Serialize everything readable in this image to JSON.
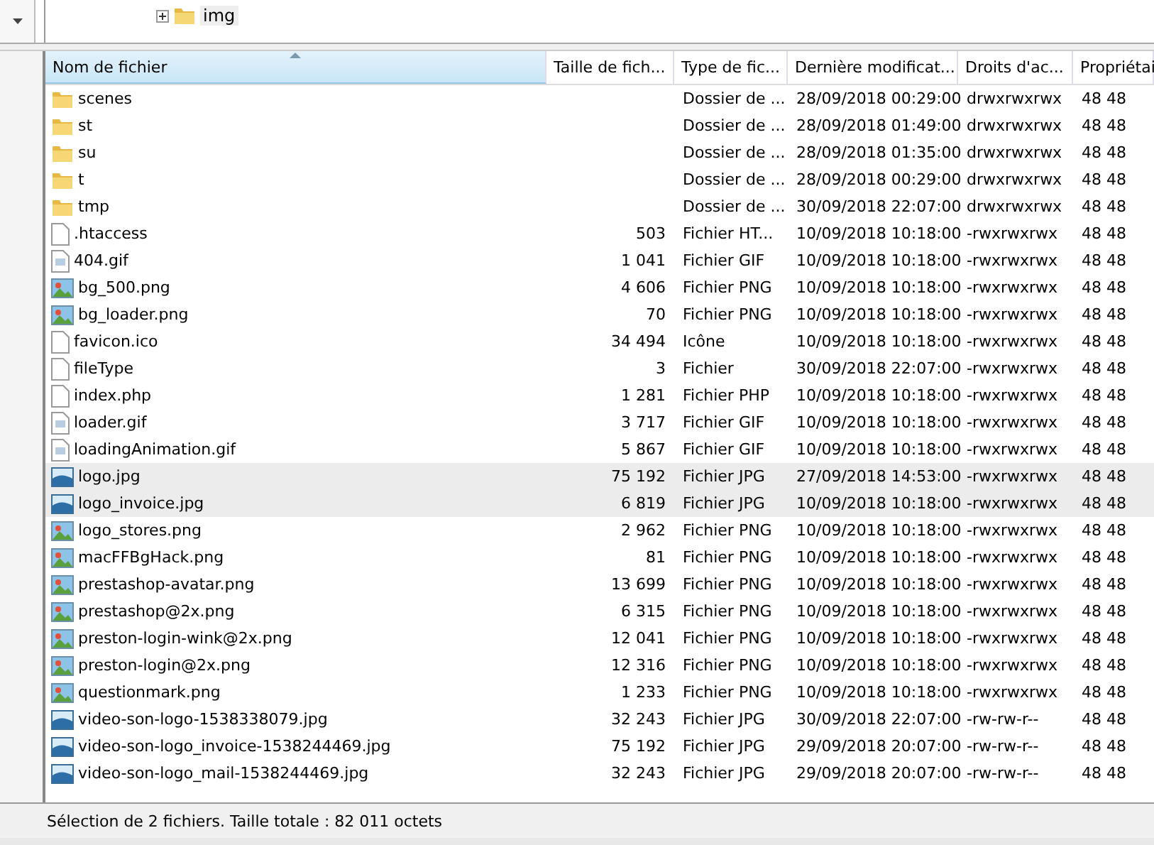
{
  "tree": {
    "items": [
      {
        "label": "img",
        "expanded": false
      }
    ]
  },
  "table": {
    "columns": [
      {
        "label": "Nom de fichier",
        "sorted": true
      },
      {
        "label": "Taille de fich...",
        "sorted": false
      },
      {
        "label": "Type de fic...",
        "sorted": false
      },
      {
        "label": "Dernière modificat...",
        "sorted": false
      },
      {
        "label": "Droits d'ac...",
        "sorted": false
      },
      {
        "label": "Propriétai",
        "sorted": false
      }
    ],
    "rows": [
      {
        "kind": "folder",
        "name": "scenes",
        "size": "",
        "type": "Dossier de ...",
        "date": "28/09/2018 00:29:00",
        "rights": "drwxrwxrwx",
        "owner": "48 48",
        "selected": false
      },
      {
        "kind": "folder",
        "name": "st",
        "size": "",
        "type": "Dossier de ...",
        "date": "28/09/2018 01:49:00",
        "rights": "drwxrwxrwx",
        "owner": "48 48",
        "selected": false
      },
      {
        "kind": "folder",
        "name": "su",
        "size": "",
        "type": "Dossier de ...",
        "date": "28/09/2018 01:35:00",
        "rights": "drwxrwxrwx",
        "owner": "48 48",
        "selected": false
      },
      {
        "kind": "folder",
        "name": "t",
        "size": "",
        "type": "Dossier de ...",
        "date": "28/09/2018 00:29:00",
        "rights": "drwxrwxrwx",
        "owner": "48 48",
        "selected": false
      },
      {
        "kind": "folder",
        "name": "tmp",
        "size": "",
        "type": "Dossier de ...",
        "date": "30/09/2018 22:07:00",
        "rights": "drwxrwxrwx",
        "owner": "48 48",
        "selected": false
      },
      {
        "kind": "blank",
        "name": ".htaccess",
        "size": "503",
        "type": "Fichier HT...",
        "date": "10/09/2018 10:18:00",
        "rights": "-rwxrwxrwx",
        "owner": "48 48",
        "selected": false
      },
      {
        "kind": "gif",
        "name": "404.gif",
        "size": "1 041",
        "type": "Fichier GIF",
        "date": "10/09/2018 10:18:00",
        "rights": "-rwxrwxrwx",
        "owner": "48 48",
        "selected": false
      },
      {
        "kind": "png",
        "name": "bg_500.png",
        "size": "4 606",
        "type": "Fichier PNG",
        "date": "10/09/2018 10:18:00",
        "rights": "-rwxrwxrwx",
        "owner": "48 48",
        "selected": false
      },
      {
        "kind": "png",
        "name": "bg_loader.png",
        "size": "70",
        "type": "Fichier PNG",
        "date": "10/09/2018 10:18:00",
        "rights": "-rwxrwxrwx",
        "owner": "48 48",
        "selected": false
      },
      {
        "kind": "blank",
        "name": "favicon.ico",
        "size": "34 494",
        "type": "Icône",
        "date": "10/09/2018 10:18:00",
        "rights": "-rwxrwxrwx",
        "owner": "48 48",
        "selected": false
      },
      {
        "kind": "blank",
        "name": "fileType",
        "size": "3",
        "type": "Fichier",
        "date": "30/09/2018 22:07:00",
        "rights": "-rwxrwxrwx",
        "owner": "48 48",
        "selected": false
      },
      {
        "kind": "blank",
        "name": "index.php",
        "size": "1 281",
        "type": "Fichier PHP",
        "date": "10/09/2018 10:18:00",
        "rights": "-rwxrwxrwx",
        "owner": "48 48",
        "selected": false
      },
      {
        "kind": "gif",
        "name": "loader.gif",
        "size": "3 717",
        "type": "Fichier GIF",
        "date": "10/09/2018 10:18:00",
        "rights": "-rwxrwxrwx",
        "owner": "48 48",
        "selected": false
      },
      {
        "kind": "gif",
        "name": "loadingAnimation.gif",
        "size": "5 867",
        "type": "Fichier GIF",
        "date": "10/09/2018 10:18:00",
        "rights": "-rwxrwxrwx",
        "owner": "48 48",
        "selected": false
      },
      {
        "kind": "jpg",
        "name": "logo.jpg",
        "size": "75 192",
        "type": "Fichier JPG",
        "date": "27/09/2018 14:53:00",
        "rights": "-rwxrwxrwx",
        "owner": "48 48",
        "selected": true
      },
      {
        "kind": "jpg",
        "name": "logo_invoice.jpg",
        "size": "6 819",
        "type": "Fichier JPG",
        "date": "10/09/2018 10:18:00",
        "rights": "-rwxrwxrwx",
        "owner": "48 48",
        "selected": true
      },
      {
        "kind": "png",
        "name": "logo_stores.png",
        "size": "2 962",
        "type": "Fichier PNG",
        "date": "10/09/2018 10:18:00",
        "rights": "-rwxrwxrwx",
        "owner": "48 48",
        "selected": false
      },
      {
        "kind": "png",
        "name": "macFFBgHack.png",
        "size": "81",
        "type": "Fichier PNG",
        "date": "10/09/2018 10:18:00",
        "rights": "-rwxrwxrwx",
        "owner": "48 48",
        "selected": false
      },
      {
        "kind": "png",
        "name": "prestashop-avatar.png",
        "size": "13 699",
        "type": "Fichier PNG",
        "date": "10/09/2018 10:18:00",
        "rights": "-rwxrwxrwx",
        "owner": "48 48",
        "selected": false
      },
      {
        "kind": "png",
        "name": "prestashop@2x.png",
        "size": "6 315",
        "type": "Fichier PNG",
        "date": "10/09/2018 10:18:00",
        "rights": "-rwxrwxrwx",
        "owner": "48 48",
        "selected": false
      },
      {
        "kind": "png",
        "name": "preston-login-wink@2x.png",
        "size": "12 041",
        "type": "Fichier PNG",
        "date": "10/09/2018 10:18:00",
        "rights": "-rwxrwxrwx",
        "owner": "48 48",
        "selected": false
      },
      {
        "kind": "png",
        "name": "preston-login@2x.png",
        "size": "12 316",
        "type": "Fichier PNG",
        "date": "10/09/2018 10:18:00",
        "rights": "-rwxrwxrwx",
        "owner": "48 48",
        "selected": false
      },
      {
        "kind": "png",
        "name": "questionmark.png",
        "size": "1 233",
        "type": "Fichier PNG",
        "date": "10/09/2018 10:18:00",
        "rights": "-rwxrwxrwx",
        "owner": "48 48",
        "selected": false
      },
      {
        "kind": "jpg",
        "name": "video-son-logo-1538338079.jpg",
        "size": "32 243",
        "type": "Fichier JPG",
        "date": "30/09/2018 22:07:00",
        "rights": "-rw-rw-r--",
        "owner": "48 48",
        "selected": false
      },
      {
        "kind": "jpg",
        "name": "video-son-logo_invoice-1538244469.jpg",
        "size": "75 192",
        "type": "Fichier JPG",
        "date": "29/09/2018 20:07:00",
        "rights": "-rw-rw-r--",
        "owner": "48 48",
        "selected": false
      },
      {
        "kind": "jpg",
        "name": "video-son-logo_mail-1538244469.jpg",
        "size": "32 243",
        "type": "Fichier JPG",
        "date": "29/09/2018 20:07:00",
        "rights": "-rw-rw-r--",
        "owner": "48 48",
        "selected": false
      }
    ]
  },
  "status_bar": "Sélection de 2 fichiers. Taille totale : 82 011 octets"
}
